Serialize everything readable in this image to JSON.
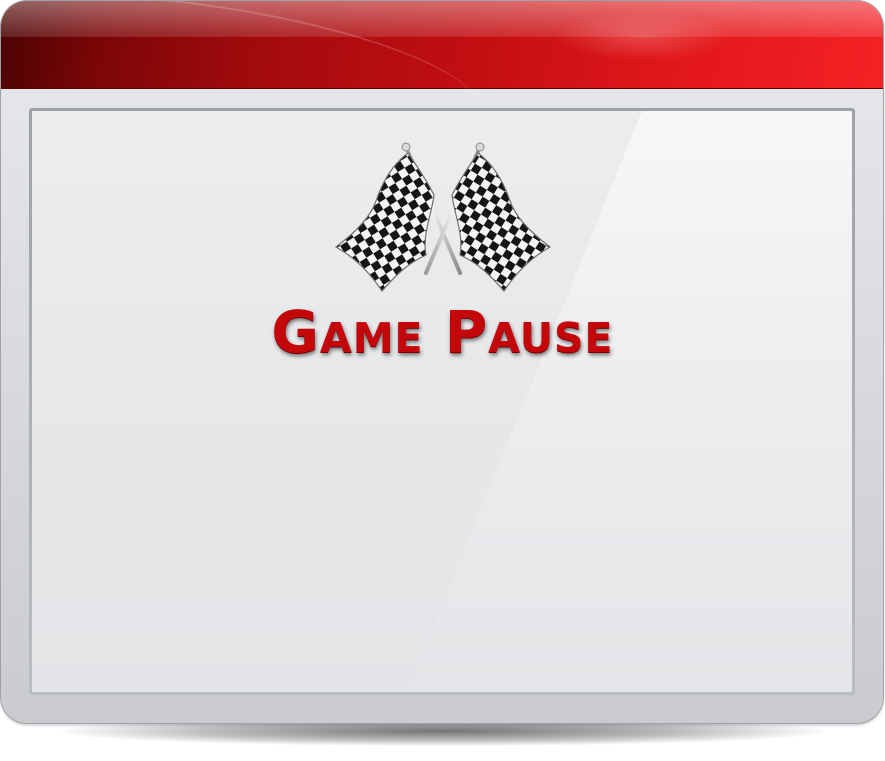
{
  "game": {
    "title": "Game Pause",
    "icon": "checkered-flags-icon"
  },
  "colors": {
    "title_bar": "#c40f12",
    "title_text": "#c3070b",
    "panel": "#efeff1",
    "frame": "#d5d7db"
  }
}
